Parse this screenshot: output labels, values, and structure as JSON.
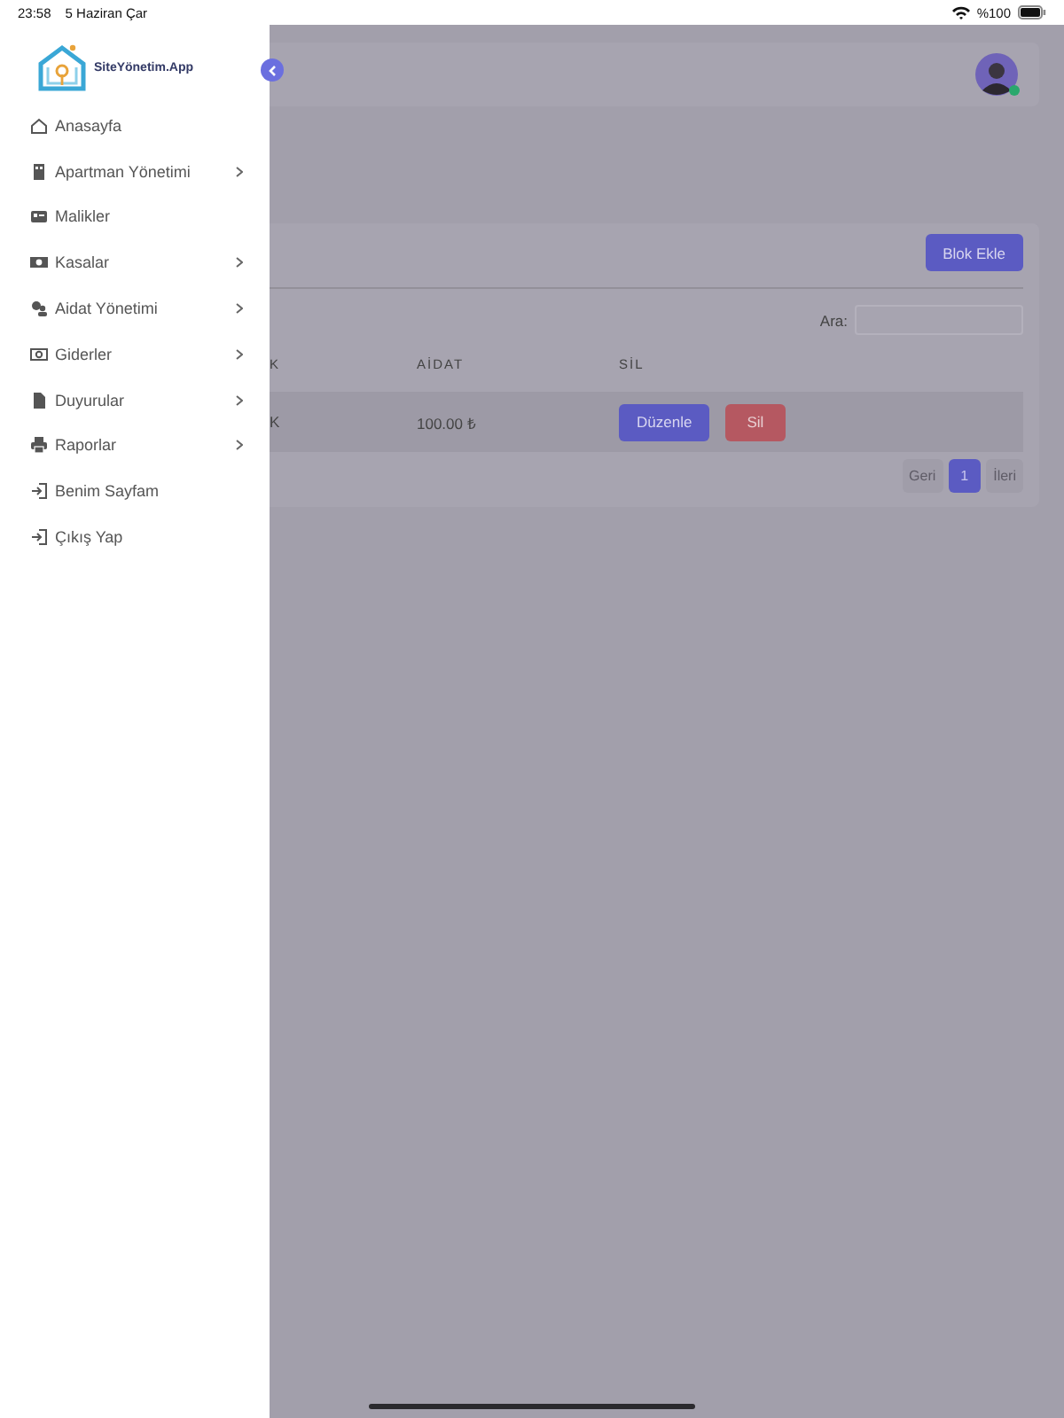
{
  "status_bar": {
    "time": "23:58",
    "date": "5 Haziran Çar",
    "battery": "%100"
  },
  "sidebar": {
    "logo": "SiteYönetim.App",
    "items": [
      {
        "label": "Anasayfa",
        "has_submenu": false
      },
      {
        "label": "Apartman Yönetimi",
        "has_submenu": true
      },
      {
        "label": "Malikler",
        "has_submenu": false
      },
      {
        "label": "Kasalar",
        "has_submenu": true
      },
      {
        "label": "Aidat Yönetimi",
        "has_submenu": true
      },
      {
        "label": "Giderler",
        "has_submenu": true
      },
      {
        "label": "Duyurular",
        "has_submenu": true
      },
      {
        "label": "Raporlar",
        "has_submenu": true
      },
      {
        "label": "Benim Sayfam",
        "has_submenu": false
      },
      {
        "label": "Çıkış Yap",
        "has_submenu": false
      }
    ]
  },
  "card": {
    "add_button": "Blok Ekle",
    "search_label": "Ara:",
    "table": {
      "columns": [
        "K",
        "AİDAT",
        "SİL"
      ],
      "rows": [
        {
          "cells": [
            "K",
            "100.00 ₺"
          ],
          "edit_button": "Düzenle",
          "delete_button": "Sil"
        }
      ]
    },
    "pagination": {
      "previous": "Geri",
      "pages": [
        {
          "label": "1",
          "selected": true
        }
      ],
      "next": "İleri"
    }
  }
}
